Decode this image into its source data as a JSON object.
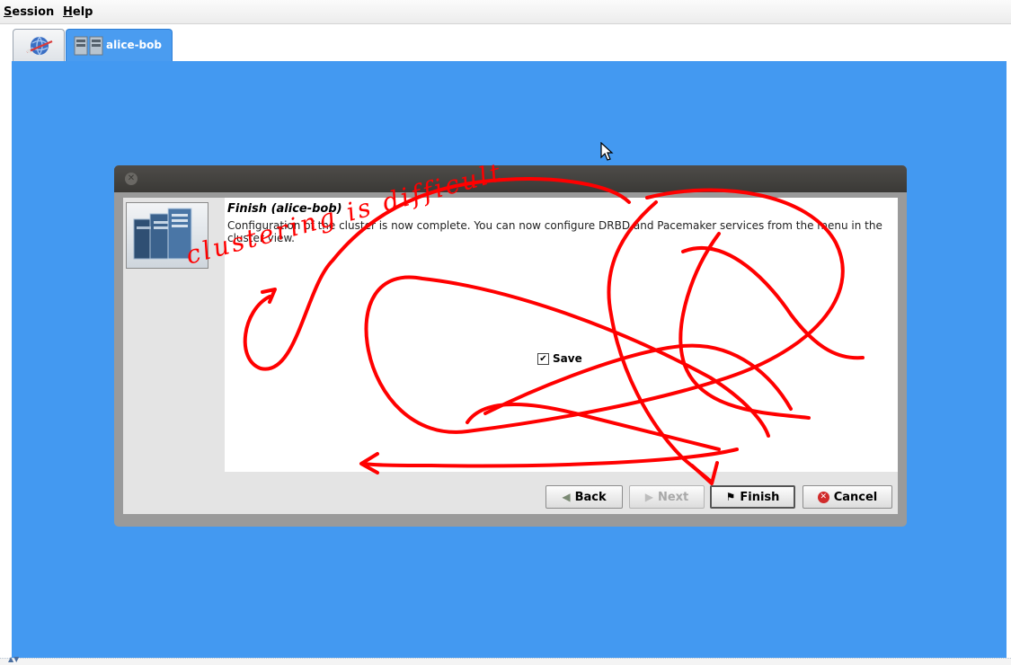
{
  "menu": {
    "session": {
      "mnemonic": "S",
      "rest": "ession"
    },
    "help": {
      "mnemonic": "H",
      "rest": "elp"
    }
  },
  "tabs": [
    {
      "icon": "network-globe-icon",
      "label": ""
    },
    {
      "icon": "cluster-servers-icon",
      "label": "alice-bob"
    }
  ],
  "dialog": {
    "title": "Finish (alice-bob)",
    "description": "Configuration of the cluster is now complete. You can now configure DRBD and Pacemaker services from the menu in the cluster view.",
    "save_label": "Save",
    "save_checked": true,
    "buttons": {
      "back": "Back",
      "next": "Next",
      "finish": "Finish",
      "cancel": "Cancel"
    }
  },
  "annotation": {
    "text": "clustering is difficult",
    "color": "#ff0000"
  },
  "colors": {
    "workspace": "#4399f1",
    "titlebar": "#3f3e3b"
  }
}
